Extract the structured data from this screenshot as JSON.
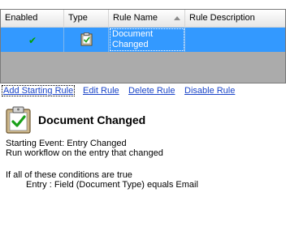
{
  "grid": {
    "columns": {
      "enabled": "Enabled",
      "type": "Type",
      "rule_name": "Rule Name",
      "rule_description": "Rule Description"
    },
    "rows": [
      {
        "enabled_icon": "checkmark",
        "type_icon": "clipboard-check-icon",
        "name_line1": "Document",
        "name_line2": "Changed",
        "description": ""
      }
    ]
  },
  "links": {
    "add_starting_rule": "Add Starting Rule",
    "edit_rule": "Edit Rule",
    "delete_rule": "Delete Rule",
    "disable_rule": "Disable Rule"
  },
  "details": {
    "title": "Document Changed",
    "starting_event": "Starting Event: Entry Changed",
    "run_workflow": "Run workflow on the entry that changed",
    "conditions_header": "If all of these conditions are true",
    "condition_1": "Entry : Field (Document Type) equals Email"
  },
  "colors": {
    "selection": "#3399ff",
    "link": "#1a44c8",
    "check": "#00a000",
    "grid_empty": "#ababab"
  }
}
